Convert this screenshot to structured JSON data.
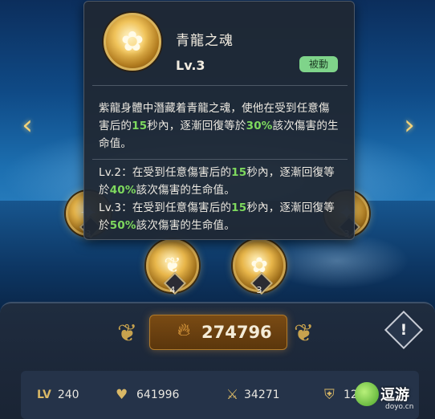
{
  "nav": {
    "prev_glyph": "‹",
    "next_glyph": "›"
  },
  "skill_orbs": [
    {
      "name": "skill-orb-left",
      "glyph": "✦",
      "icon": "gold-skill-icon",
      "level": "3"
    },
    {
      "name": "skill-orb-dragon",
      "glyph": "❦",
      "icon": "golden-dragon-icon",
      "level": "4"
    },
    {
      "name": "skill-orb-azure-dragon",
      "glyph": "✿",
      "icon": "azure-dragon-soul-icon",
      "level": "3"
    },
    {
      "name": "skill-orb-right",
      "glyph": "✦",
      "icon": "gold-skill-icon",
      "level": "3"
    }
  ],
  "tooltip": {
    "icon": "azure-dragon-soul-icon",
    "title": "青龍之魂",
    "level": "Lv.3",
    "tag": "被動",
    "desc": [
      {
        "t": "紫龍身體中潛藏着青龍之魂，使他在受到任意傷害后的",
        "h": false
      },
      {
        "t": "15",
        "h": true
      },
      {
        "t": "秒內，逐漸回復等於",
        "h": false
      },
      {
        "t": "30%",
        "h": true
      },
      {
        "t": "該次傷害的生命值。",
        "h": false
      }
    ],
    "levels": [
      [
        {
          "t": "Lv.2：在受到任意傷害后的",
          "h": false
        },
        {
          "t": "15",
          "h": true
        },
        {
          "t": "秒內，逐漸回復等於",
          "h": false
        },
        {
          "t": "40%",
          "h": true
        },
        {
          "t": "該次傷害的生命值。",
          "h": false
        }
      ],
      [
        {
          "t": "Lv.3：在受到任意傷害后的",
          "h": false
        },
        {
          "t": "15",
          "h": true
        },
        {
          "t": "秒內，逐漸回復等於",
          "h": false
        },
        {
          "t": "50%",
          "h": true
        },
        {
          "t": "該次傷害的生命值。",
          "h": false
        }
      ]
    ],
    "highlight_color": "#7ed95e"
  },
  "power": {
    "icon": "flame-icon",
    "value": "274796"
  },
  "info_button": {
    "label": "!"
  },
  "stats": {
    "level_label": "LV",
    "level_value": "240",
    "hp_value": "641996",
    "attack_value": "34271",
    "defense_value": "12632"
  },
  "watermark": {
    "text": "逗游",
    "sub": "doyo.cn"
  },
  "colors": {
    "accent_gold": "#d9b866",
    "tag_green": "#7fd48a"
  }
}
